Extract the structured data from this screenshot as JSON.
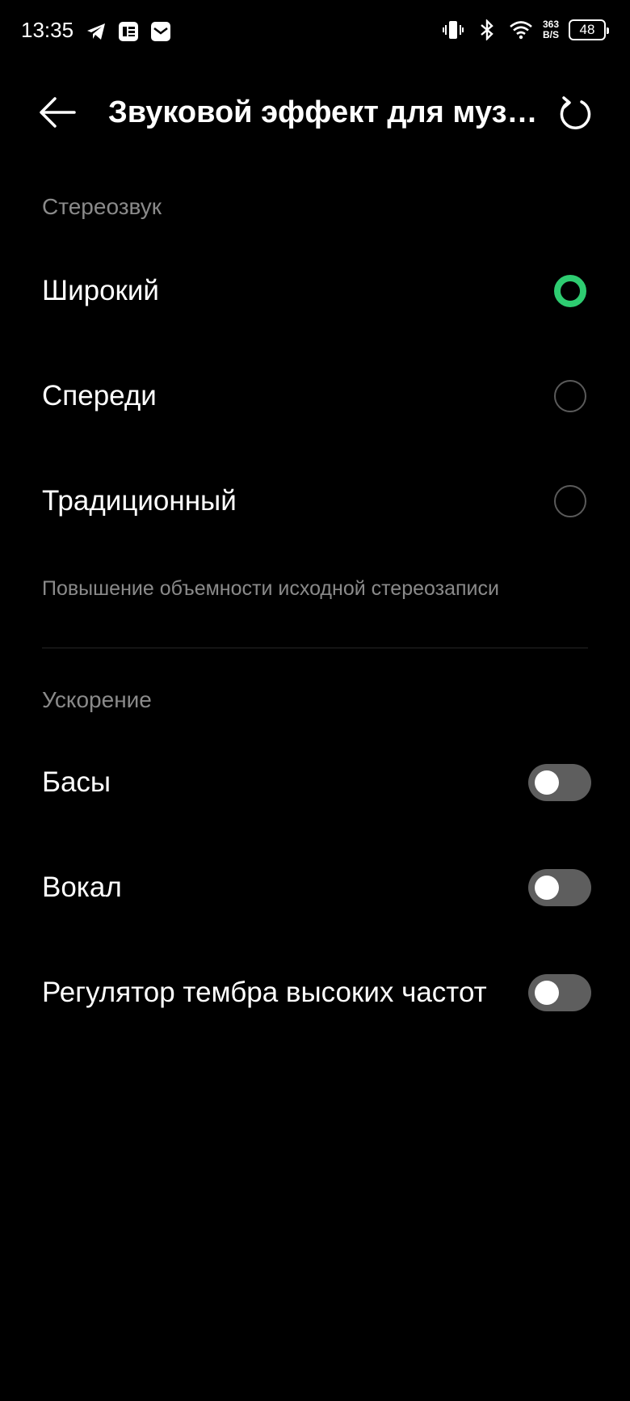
{
  "status_bar": {
    "time": "13:35",
    "net_speed_value": "363",
    "net_speed_unit": "B/S",
    "battery": "48",
    "icons": [
      "telegram-icon",
      "news-icon",
      "mail-icon",
      "vibrate-icon",
      "bluetooth-icon",
      "wifi-icon"
    ]
  },
  "header": {
    "title": "Звуковой эффект для музыки",
    "back_icon": "arrow-left-icon",
    "reset_icon": "reset-icon"
  },
  "stereo": {
    "section_title": "Стереозвук",
    "options": [
      {
        "label": "Широкий",
        "selected": true
      },
      {
        "label": "Спереди",
        "selected": false
      },
      {
        "label": "Традиционный",
        "selected": false
      }
    ],
    "description": "Повышение объемности исходной стереозаписи"
  },
  "boost": {
    "section_title": "Ускорение",
    "toggles": [
      {
        "label": "Басы",
        "on": false
      },
      {
        "label": "Вокал",
        "on": false
      },
      {
        "label": "Регулятор тембра высоких частот",
        "on": false
      }
    ]
  },
  "colors": {
    "background": "#000000",
    "accent": "#2ecc71",
    "secondary_text": "#8a8a8a",
    "toggle_off": "#5e5e5e"
  }
}
